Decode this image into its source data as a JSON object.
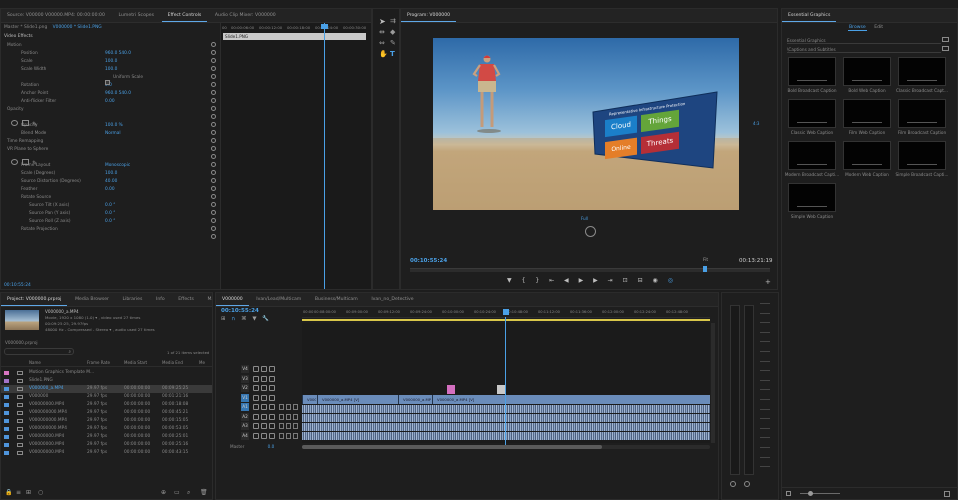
{
  "source_monitor": {
    "tabs": [
      "Source: V00000 V00000.MP4: 00:00:00:00",
      "Lumetri Scopes",
      "Effect Controls",
      "Audio Clip Mixer: V000000"
    ],
    "active_tab": 2,
    "master_label": "Master * Slide1.png",
    "clip_label": "V000000 * Slide1.PNG",
    "video_effects_header": "Video Effects",
    "properties": [
      {
        "name": "Motion",
        "value": ""
      },
      {
        "name": "Position",
        "value": "960.0   540.0"
      },
      {
        "name": "Scale",
        "value": "100.0"
      },
      {
        "name": "Scale Width",
        "value": "100.0"
      },
      {
        "name": "",
        "value": "Uniform Scale"
      },
      {
        "name": "Rotation",
        "value": "0.0"
      },
      {
        "name": "Anchor Point",
        "value": "960.0   540.0"
      },
      {
        "name": "Anti-flicker Filter",
        "value": "0.00"
      },
      {
        "name": "Opacity",
        "value": ""
      },
      {
        "name": "",
        "value": ""
      },
      {
        "name": "Opacity",
        "value": "100.0 %"
      },
      {
        "name": "Blend Mode",
        "value": "Normal"
      },
      {
        "name": "Time Remapping",
        "value": ""
      },
      {
        "name": "VR Plane to Sphere",
        "value": ""
      },
      {
        "name": "",
        "value": ""
      },
      {
        "name": "Frame Layout",
        "value": "Monoscopic"
      },
      {
        "name": "Scale (Degrees)",
        "value": "100.0"
      },
      {
        "name": "Source Distortion (Degrees)",
        "value": "40.00"
      },
      {
        "name": "Feather",
        "value": "0.00"
      },
      {
        "name": "Rotate Source",
        "value": ""
      },
      {
        "name": "Source Tilt (X axis)",
        "value": "0.0 °"
      },
      {
        "name": "Source Pan (Y axis)",
        "value": "0.0 °"
      },
      {
        "name": "Source Roll (Z axis)",
        "value": "0.0 °"
      },
      {
        "name": "Rotate Projection",
        "value": ""
      }
    ],
    "mini_timeline": {
      "ruler": [
        "00",
        "00:00:06:00",
        "00:00:12:00",
        "00:00:18:00",
        "00:00:24:00",
        "00:00:30:00"
      ],
      "clip_name": "Slide1.PNG"
    },
    "timecode": "00:10:55:24"
  },
  "tools": [
    "selection",
    "track-select",
    "ripple-edit",
    "razor",
    "slip",
    "pen",
    "hand",
    "type"
  ],
  "program_monitor": {
    "tab": "Program: V000000",
    "timecode": "00:10:55:24",
    "fit": "Fit",
    "duration": "00:13:21:19",
    "safe_label": "Full",
    "overlay_card": {
      "title": "Representative Infrastructure Protection",
      "tiles": [
        {
          "label": "Cloud",
          "color": "#1b7fc9"
        },
        {
          "label": "Things",
          "color": "#64a53a"
        },
        {
          "label": "Online",
          "color": "#e47e28"
        },
        {
          "label": "Threats",
          "color": "#b52f37"
        }
      ]
    }
  },
  "essential_graphics": {
    "title": "Essential Graphics",
    "tabs": [
      "Browse",
      "Edit"
    ],
    "dropdown1": "Essential Graphics",
    "dropdown2": "\\Captions and Subtitles",
    "templates": [
      "Bold Broadcast Caption",
      "Bold Web Caption",
      "Classic Broadcast Capt...",
      "Classic Web Caption",
      "Film Web Caption",
      "Film Broadcast Caption",
      "Modern Broadcast Capti...",
      "Modern Web Caption",
      "Simple Broadcast Capti...",
      "Simple Web Caption"
    ]
  },
  "project_panel": {
    "tabs": [
      "Project: V000000.prproj",
      "Media Browser",
      "Libraries",
      "Info",
      "Effects",
      "Marker"
    ],
    "preview": {
      "name": "V000000_a.MP4",
      "info1": "Movie, 1920 x 1080 (1.0) ▾ , video used 27 times",
      "info2": "00:09:25:25, 29.97fps",
      "info3": "48000 Hz - Compressed - Stereo ▾ , audio used 27 times"
    },
    "path": "V000000.prproj",
    "items_selected": "1 of 21 items selected",
    "columns": [
      "Name",
      "Frame Rate",
      "Media Start",
      "Media End",
      "Me"
    ],
    "rows": [
      {
        "name": "Motion Graphics Template M...",
        "fps": "",
        "start": "",
        "end": "",
        "color": "#d975c3"
      },
      {
        "name": "Slide1.PNG",
        "fps": "",
        "start": "",
        "end": "",
        "color": "#a373c9"
      },
      {
        "name": "V000000_a.MP4",
        "fps": "29.97 fps",
        "start": "00:00:00:00",
        "end": "00:09:25:25",
        "color": "#4f95dc"
      },
      {
        "name": "V000000",
        "fps": "29.97 fps",
        "start": "00:00:00:00",
        "end": "00:01:21:16",
        "color": "#4f95dc"
      },
      {
        "name": "V00000000.MP4",
        "fps": "29.97 fps",
        "start": "00:00:00:00",
        "end": "00:00:18:08",
        "color": "#4f95dc"
      },
      {
        "name": "V000000000.MP4",
        "fps": "29.97 fps",
        "start": "00:00:00:00",
        "end": "00:00:45:21",
        "color": "#4f95dc"
      },
      {
        "name": "V000000000.MP4",
        "fps": "29.97 fps",
        "start": "00:00:00:00",
        "end": "00:00:15:05",
        "color": "#4f95dc"
      },
      {
        "name": "V000000000.MP4",
        "fps": "29.97 fps",
        "start": "00:00:00:00",
        "end": "00:00:53:05",
        "color": "#4f95dc"
      },
      {
        "name": "V00000000.MP4",
        "fps": "29.97 fps",
        "start": "00:00:00:00",
        "end": "00:00:25:01",
        "color": "#4f95dc"
      },
      {
        "name": "V00000000.MP4",
        "fps": "29.97 fps",
        "start": "00:00:00:00",
        "end": "00:00:25:16",
        "color": "#4f95dc"
      },
      {
        "name": "V00000000.MP4",
        "fps": "29.97 fps",
        "start": "00:00:00:00",
        "end": "00:00:43:15",
        "color": "#4f95dc"
      }
    ]
  },
  "timeline": {
    "tabs": [
      "V000000",
      "Ivan/Lead/Multicam",
      "Business/Multicam",
      "Ivan_no_Detective"
    ],
    "timecode": "00:10:55:24",
    "ruler": [
      "00:00",
      "00:08:00:00",
      "00:09:00:00",
      "00:09:12:00",
      "00:09:24:00",
      "00:10:00:00",
      "00:10:24:00",
      "00:10:48:00",
      "00:11:12:00",
      "00:11:36:00",
      "00:12:00:00",
      "00:12:24:00",
      "00:12:48:00"
    ],
    "tracks": [
      "V4",
      "V3",
      "V2",
      "V1",
      "A1",
      "A2",
      "A3",
      "A4"
    ],
    "master_label": "Master",
    "master_value": "0.0",
    "clips": [
      {
        "name": "V000000_a.MP4 [V]"
      },
      {
        "name": "V000000_a.MP4 [V]"
      },
      {
        "name": "V000000_a.MP4 [V]"
      },
      {
        "name": "V000000_a.MP4 [V]"
      }
    ]
  }
}
